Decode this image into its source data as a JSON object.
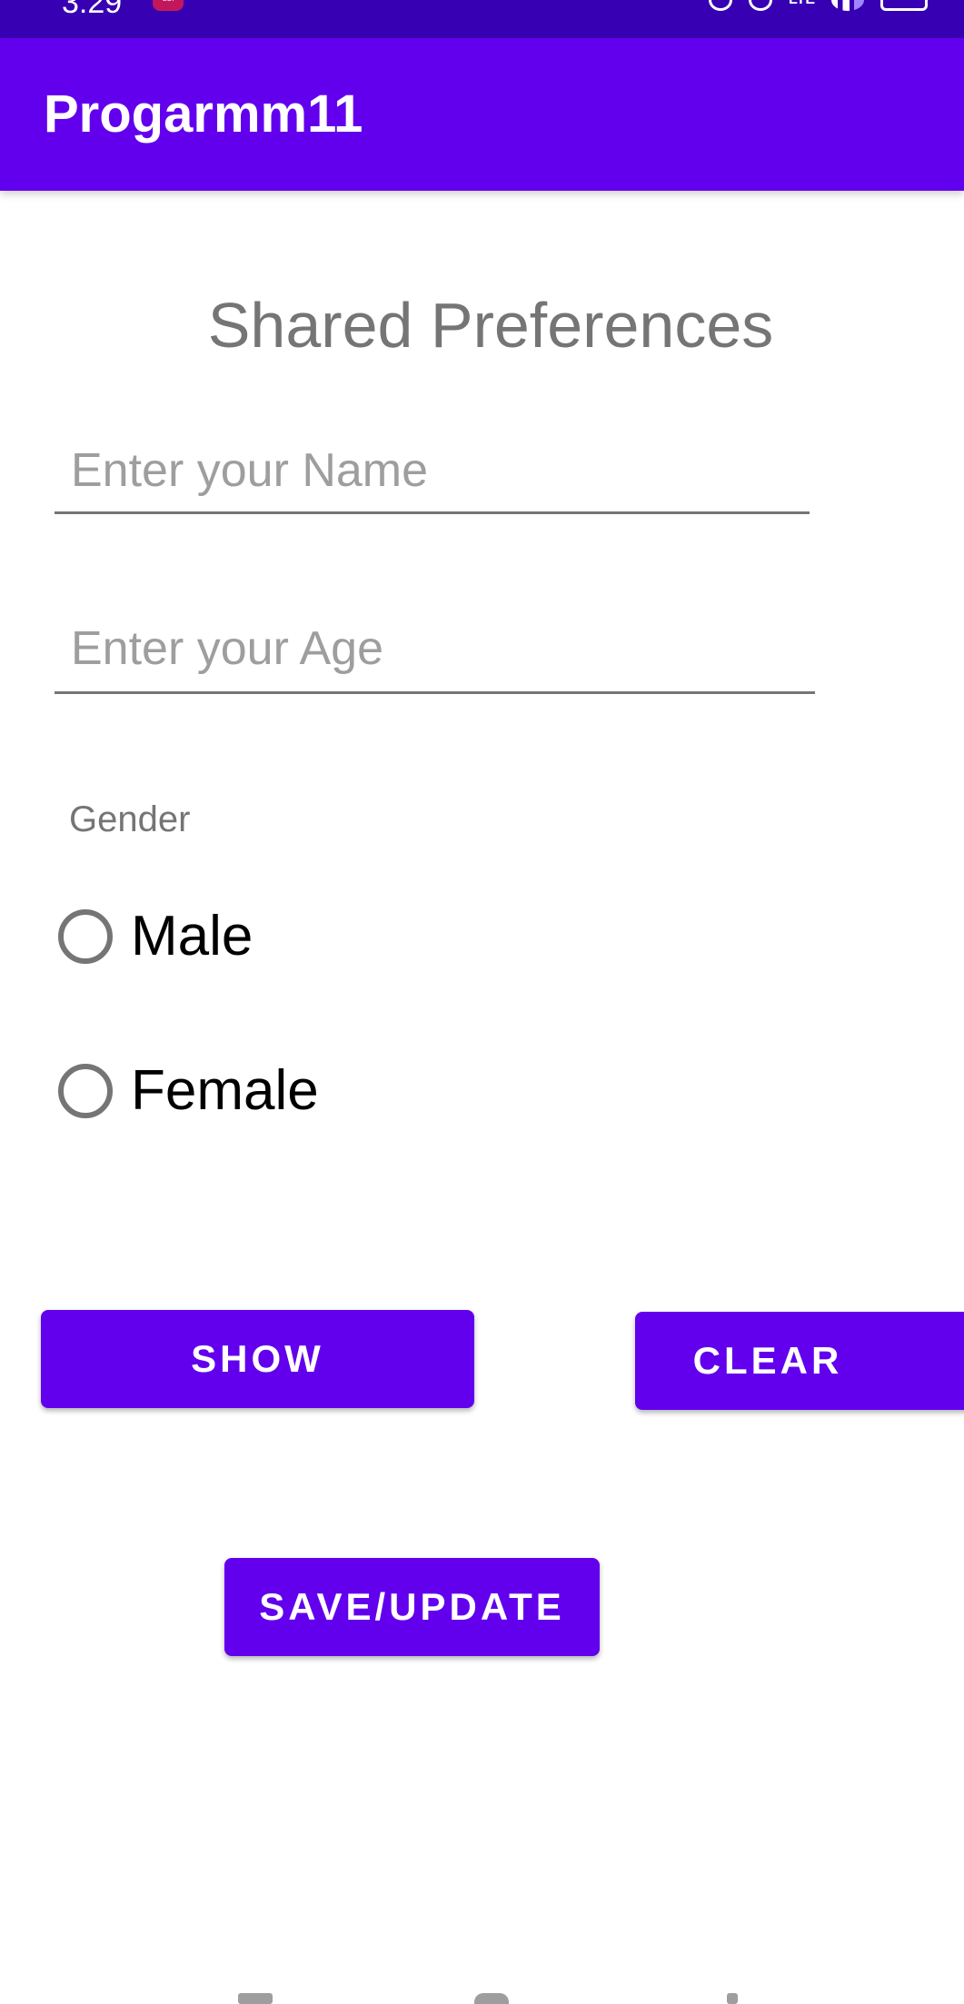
{
  "status_bar": {
    "time": "3:29",
    "app_badge": "SBI",
    "network": "LTE"
  },
  "app_bar": {
    "title": "Progarmm11"
  },
  "main": {
    "heading": "Shared Preferences",
    "name_field": {
      "placeholder": "Enter your Name",
      "value": ""
    },
    "age_field": {
      "placeholder": "Enter your Age",
      "value": ""
    },
    "gender": {
      "label": "Gender",
      "options": [
        "Male",
        "Female"
      ],
      "selected": null
    },
    "buttons": {
      "show": "SHOW",
      "clear": "CLEAR",
      "save": "SAVE/UPDATE"
    }
  },
  "colors": {
    "status_bar": "#3700b3",
    "primary": "#6200ee",
    "heading_text": "#757575"
  }
}
